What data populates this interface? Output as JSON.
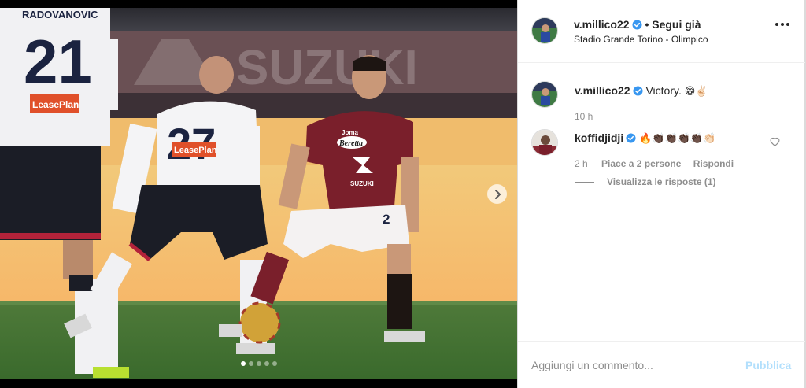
{
  "post": {
    "author": {
      "username": "v.millico22",
      "verified": true,
      "follow_separator": "•",
      "follow_status": "Segui già",
      "location": "Stadio Grande Torino - Olimpico"
    },
    "media": {
      "slide_count": 5,
      "current_slide": 1,
      "next_icon": "chevron-right-icon",
      "photo_texts": {
        "back_name": "RADOVANOVIC",
        "left_number": "21",
        "center_number": "27",
        "sponsor": "LeasePlan",
        "board": "SUZUKI",
        "shirt_brand": "Joma",
        "shirt_sponsor": "Beretta",
        "shirt_main_sponsor": "SUZUKI",
        "shorts_number": "2"
      }
    },
    "caption": {
      "username": "v.millico22",
      "verified": true,
      "text": "Victory.",
      "emoji": "😁✌🏻",
      "time": "10 h"
    },
    "comments": [
      {
        "username": "koffidjidji",
        "verified": true,
        "emoji": "🔥👏🏿👏🏿👏🏿👏🏿👏🏻",
        "time": "2 h",
        "likes": "Piace a 2 persone",
        "reply_label": "Rispondi",
        "view_replies": "Visualizza le risposte (1)",
        "like_icon": "heart-outline-icon"
      }
    ],
    "add_comment": {
      "placeholder": "Aggiungi un commento...",
      "submit_label": "Pubblica",
      "submit_color": "#b2dffc"
    }
  },
  "colors": {
    "verified": "#3897f0",
    "text": "#262626",
    "muted": "#8e8e8e",
    "torino_maroon": "#7a1f2b",
    "genoa_navy": "#1b2340"
  }
}
